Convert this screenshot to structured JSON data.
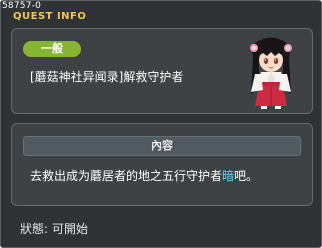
{
  "window": {
    "quest_id": "58757-0",
    "title": "QUEST INFO"
  },
  "quest": {
    "category": "一般",
    "name": "[蘑菇神社异闻录]解救守护者",
    "npc_icon": "shrine-maiden-npc-portrait"
  },
  "content": {
    "header": "內容",
    "description_before": "去救出成为蘑居者的地之五行守护者",
    "description_highlight": "暗",
    "description_after": "吧。",
    "highlight_color": "#6fd0ff"
  },
  "status": {
    "label": "狀態:",
    "value": "可開始"
  },
  "colors": {
    "title": "#f2c94c",
    "badge": "#86b534",
    "window_bg": "#2f3336"
  }
}
